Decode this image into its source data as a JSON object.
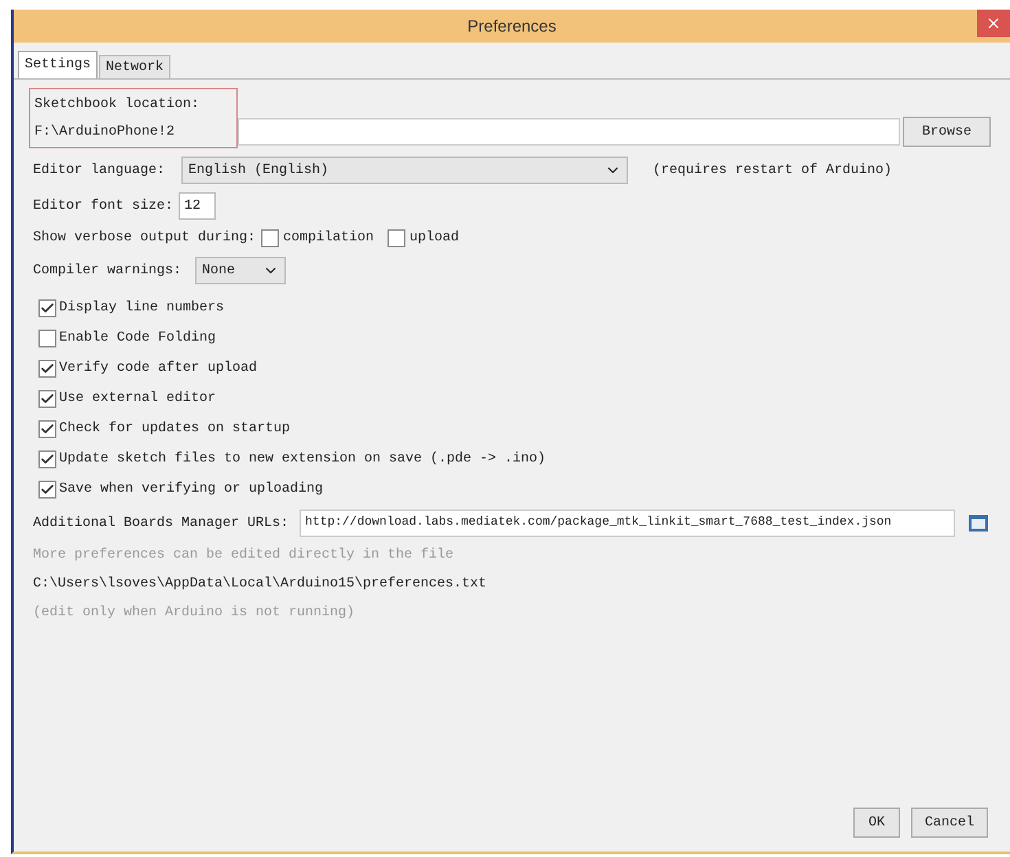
{
  "window": {
    "title": "Preferences"
  },
  "tabs": [
    {
      "label": "Settings",
      "selected": true
    },
    {
      "label": "Network",
      "selected": false
    }
  ],
  "sketchbook": {
    "label": "Sketchbook location:",
    "value": "F:\\ArduinoPhone!2",
    "highlighted": true,
    "button": "Browse"
  },
  "editor_language": {
    "label": "Editor language:",
    "value": "English (English)",
    "note": "(requires restart of Arduino)"
  },
  "editor_font_size": {
    "label": "Editor font size:",
    "value": "12"
  },
  "verbose_output": {
    "label": "Show verbose output during:",
    "options": [
      {
        "label": "compilation",
        "checked": false
      },
      {
        "label": "upload",
        "checked": false
      }
    ]
  },
  "compiler_warnings": {
    "label": "Compiler warnings:",
    "value": "None"
  },
  "options": [
    {
      "label": "Display line numbers",
      "checked": true
    },
    {
      "label": "Enable Code Folding",
      "checked": false
    },
    {
      "label": "Verify code after upload",
      "checked": true
    },
    {
      "label": "Use external editor",
      "checked": true
    },
    {
      "label": "Check for updates on startup",
      "checked": true
    },
    {
      "label": "Update sketch files to new extension on save (.pde -> .ino)",
      "checked": true
    },
    {
      "label": "Save when verifying or uploading",
      "checked": true
    }
  ],
  "boards_manager": {
    "label": "Additional Boards Manager URLs:",
    "value": "http://download.labs.mediatek.com/package_mtk_linkit_smart_7688_test_index.json"
  },
  "notes": {
    "hint": "More preferences can be edited directly in the file",
    "path": "C:\\Users\\lsoves\\AppData\\Local\\Arduino15\\preferences.txt",
    "warning": "(edit only when Arduino is not running)"
  },
  "buttons": [
    "OK",
    "Cancel"
  ]
}
